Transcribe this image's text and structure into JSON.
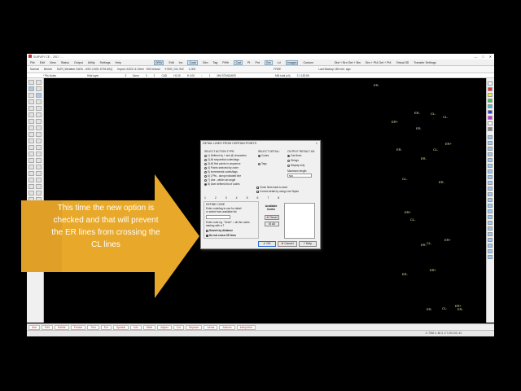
{
  "window": {
    "title": "SURVEY CE...  2017 ...",
    "controls": [
      "—",
      "□",
      "✕"
    ]
  },
  "menu": {
    "items": [
      "File",
      "Edit",
      "View",
      "Status",
      "Output",
      "Utility",
      "Settings",
      "Help"
    ],
    "right_items": [
      "DRW",
      "Edit",
      "Inv",
      "Code",
      "Dim",
      "Tag",
      "Pt/Hr",
      "Cad",
      "Pt",
      "Pnt",
      "Get",
      "Ld",
      "Images",
      "Custom"
    ],
    "far_right": [
      "Dist + Brn  Get + Brn",
      "Brn + Pt4  Get + Pt4",
      "Virtual 3D",
      "Transfer Settings"
    ]
  },
  "toolbar2": {
    "items": [
      "Normal",
      "Berlah",
      "SUR  |  Weather DATA - USE LSOD DTM ASQ",
      "Import: ASCII & Other  ·  HM Ireland",
      "9 905 | 011 902",
      "1,000",
      "FREE",
      "Last Backup 180 min. ago"
    ]
  },
  "toolbar3": {
    "items": [
      "* Pts Notes",
      "Hide layer",
      "3",
      "Norm",
      "0",
      "2",
      "CAD",
      "H1.00",
      "H 3.00",
      "↑",
      "1",
      "MM STANDARD",
      "MM total (ch)",
      "3 1 183.65"
    ]
  },
  "canvas_points": [
    {
      "label": "ER-",
      "cls": "w"
    },
    {
      "label": "ER-"
    },
    {
      "label": "CL-"
    },
    {
      "label": "ER+"
    },
    {
      "label": "ER-",
      "cls": "w"
    },
    {
      "label": "CL-"
    },
    {
      "label": "ER-"
    },
    {
      "label": "CL-"
    },
    {
      "label": "ER+"
    },
    {
      "label": "ER-"
    },
    {
      "label": "CL-"
    },
    {
      "label": "ER-"
    },
    {
      "label": "ER+"
    },
    {
      "label": "CL-"
    },
    {
      "label": "ER-"
    },
    {
      "label": "ER+"
    },
    {
      "label": "CL-"
    },
    {
      "label": "ER+"
    },
    {
      "label": "ER-"
    },
    {
      "label": "ER-"
    },
    {
      "label": "CL-"
    },
    {
      "label": "ER-"
    },
    {
      "label": "ER+"
    }
  ],
  "bottom_tabs": [
    "Aoe",
    "Edit",
    "Delete",
    "Forwar",
    "Trim",
    "Ext",
    "Special",
    "Info",
    "Wale",
    "Adjust",
    "Cut",
    "Replace",
    "viersa",
    "Actions",
    "Interpretor"
  ],
  "status": {
    "coords": "4 .7052 4 .60     3 .2 7.20 0.00 .41"
  },
  "callout": {
    "text": "This time the new option is checked and that will prevent the ER lines from crossing the CL lines"
  },
  "dialog": {
    "title": "DETAIL LINES FROM CERTAIN POINTS",
    "close": "×",
    "select_action_label": "SELECT ACTION TYPE:",
    "actions": [
      "1) Defined by + and @ characters",
      "2) All sequential codes/tags",
      "3) All first points in sequence",
      "4) Points selected by order",
      "5) Incremental codes/tags",
      "6) 2 Pts - along indicated line",
      "7) Use - within set angle",
      "8) User defined list of codes"
    ],
    "select_detail_label": "SELECT DETAIL:",
    "details": [
      "Codes",
      "Tags"
    ],
    "output_label": "OUTPUT RESULT AS:",
    "outputs": [
      "Cad lines",
      "Strings",
      "Display only"
    ],
    "max_length_label": "Maximum length",
    "max_length_value": "500",
    "close_lines_label": "Close lines back to start",
    "control_detail_label": "Control detail by using Line Styles",
    "tabs": [
      "1",
      "2",
      "3",
      "4",
      "5",
      "6",
      "7",
      "8"
    ],
    "define_code_label": "DEFINE CODE",
    "define_code_help": "Enter code/tag to use for detail or select from available list",
    "enter_code_help": "Enter code eg. 'Trees*' = all the codes starting with a T",
    "search_by_distance": "Search by distance",
    "do_not_cross": "Do not cross CE lines",
    "available_codes_label": "Available Codes",
    "reset_button": "Reset",
    "all_button": "All",
    "ok_button": "OK",
    "cancel_button": "Cancel",
    "help_button": "Help"
  },
  "colors": {
    "arrow": "#E8A82A",
    "canvas": "#000000",
    "point_label": "#E8E8A8"
  }
}
